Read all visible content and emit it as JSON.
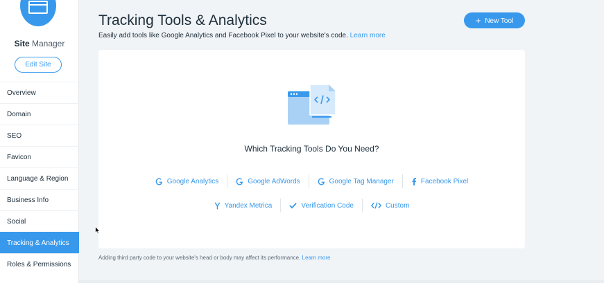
{
  "sidebar": {
    "site_title_bold": "Site",
    "site_title_light": "Manager",
    "edit_site_label": "Edit Site",
    "items": [
      {
        "label": "Overview"
      },
      {
        "label": "Domain"
      },
      {
        "label": "SEO"
      },
      {
        "label": "Favicon"
      },
      {
        "label": "Language & Region"
      },
      {
        "label": "Business Info"
      },
      {
        "label": "Social"
      },
      {
        "label": "Tracking & Analytics",
        "active": true
      },
      {
        "label": "Roles & Permissions"
      }
    ]
  },
  "main": {
    "title": "Tracking Tools & Analytics",
    "subtitle": "Easily add tools like Google Analytics and Facebook Pixel to your website's code.",
    "subtitle_link": "Learn more",
    "new_tool_label": "New Tool",
    "card": {
      "question": "Which Tracking Tools Do You Need?",
      "tools_row1": [
        {
          "label": "Google Analytics",
          "icon": "google-icon"
        },
        {
          "label": "Google AdWords",
          "icon": "google-icon"
        },
        {
          "label": "Google Tag Manager",
          "icon": "google-icon"
        },
        {
          "label": "Facebook Pixel",
          "icon": "facebook-icon"
        }
      ],
      "tools_row2": [
        {
          "label": "Yandex Metrica",
          "icon": "yandex-icon"
        },
        {
          "label": "Verification Code",
          "icon": "checkmark-icon"
        },
        {
          "label": "Custom",
          "icon": "code-icon"
        }
      ]
    },
    "footer_note": "Adding third party code to your website's head or body may affect its performance.",
    "footer_link": "Learn more"
  },
  "colors": {
    "accent": "#3899ec",
    "background": "#f0f4f7",
    "text": "#20303c"
  }
}
